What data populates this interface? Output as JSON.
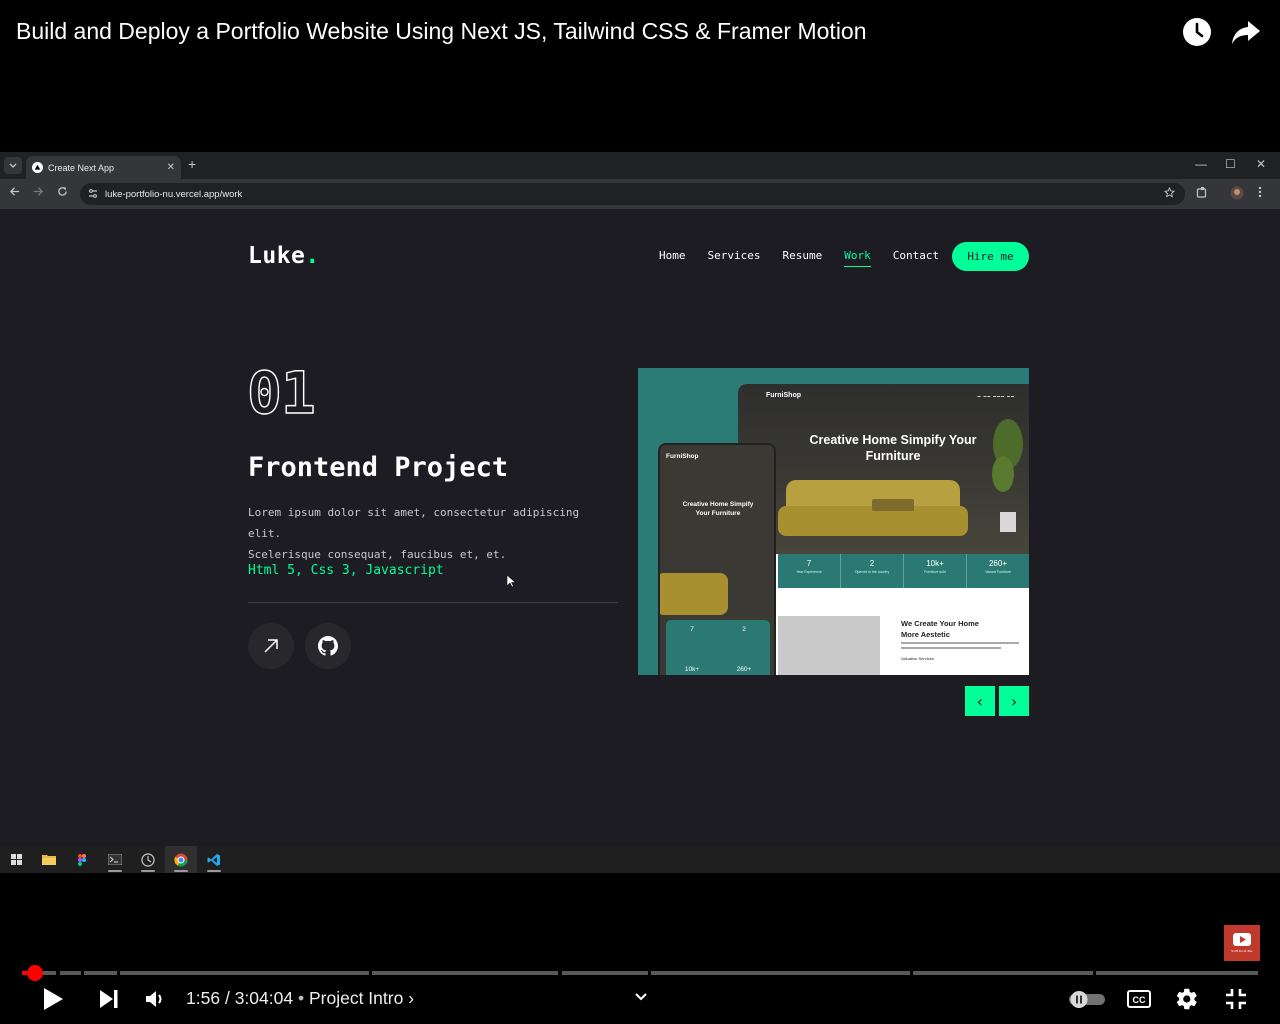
{
  "player": {
    "video_title": "Build and Deploy a Portfolio Website Using Next JS, Tailwind CSS & Framer Motion",
    "current_time": "1:56",
    "duration": "3:04:04",
    "time_separator": "/",
    "chapter_separator": "•",
    "chapter": "Project Intro",
    "chapter_chevron": "›",
    "progress_fraction": 0.0105,
    "subscribe_badge_label": "SUBSCRIBE",
    "icons": [
      "watch-later-icon",
      "share-icon",
      "play-icon",
      "next-icon",
      "volume-icon",
      "autoplay-toggle-icon",
      "captions-icon",
      "settings-icon",
      "exit-fullscreen-icon"
    ]
  },
  "browser": {
    "tab_title": "Create Next App",
    "tab_close": "✕",
    "new_tab": "+",
    "url": "luke-portfolio-nu.vercel.app/work",
    "window_controls": {
      "minimize": "—",
      "maximize": "☐",
      "close": "✕"
    }
  },
  "site": {
    "logo": "Luke",
    "logo_dot": ".",
    "nav": [
      {
        "label": "Home",
        "active": false
      },
      {
        "label": "Services",
        "active": false
      },
      {
        "label": "Resume",
        "active": false
      },
      {
        "label": "Work",
        "active": true
      },
      {
        "label": "Contact",
        "active": false
      }
    ],
    "hire_button": "Hire me",
    "accent_color": "#00ff99",
    "background_color": "#1c1c22",
    "project": {
      "number": "01",
      "title": "Frontend Project",
      "description_line1": "Lorem ipsum dolor sit amet, consectetur adipiscing elit.",
      "description_line2": "Scelerisque consequat, faucibus et, et.",
      "stack": "Html 5, Css 3, Javascript"
    },
    "thumbnail": {
      "desktop_brand": "FurniShop",
      "desktop_heading_line1": "Creative Home Simpify Your",
      "desktop_heading_line2": "Furniture",
      "stats": [
        {
          "value": "7",
          "label": "Year Experience"
        },
        {
          "value": "2",
          "label": "Opened in the country"
        },
        {
          "value": "10k+",
          "label": "Furniture sold"
        },
        {
          "value": "260+",
          "label": "Variant Furniture"
        }
      ],
      "lower_title_line1": "We Create Your Home",
      "lower_title_line2": "More Aestetic",
      "lower_item": "Valuation Services",
      "mobile_brand": "FurniShop",
      "mobile_heading_line1": "Creative Home Simpify",
      "mobile_heading_line2": "Your Furniture",
      "mobile_stats": [
        "7",
        "2",
        "10k+",
        "260+"
      ]
    },
    "slider_prev": "‹",
    "slider_next": "›"
  },
  "taskbar": {
    "apps": [
      "windows-start-icon",
      "file-explorer-icon",
      "figma-icon",
      "terminal-icon",
      "clock-app-icon",
      "chrome-icon",
      "vscode-icon"
    ]
  }
}
